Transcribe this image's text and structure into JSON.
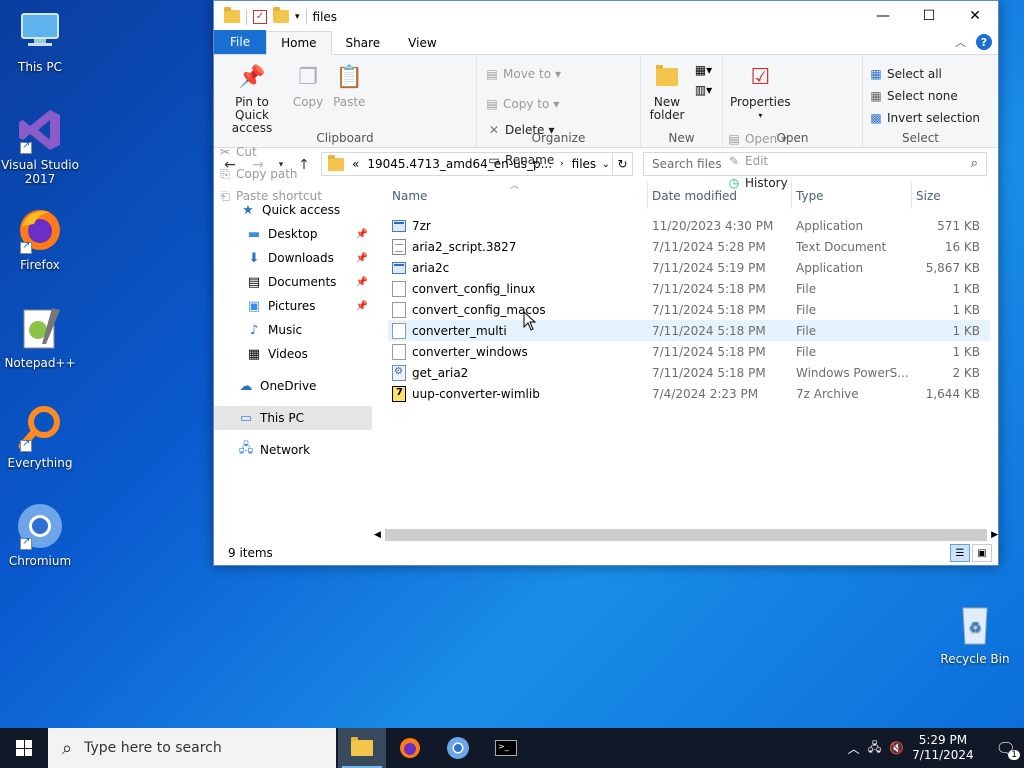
{
  "desktop": {
    "icons": [
      {
        "label": "This PC"
      },
      {
        "label": "Visual Studio\n2017"
      },
      {
        "label": "Firefox"
      },
      {
        "label": "Notepad++"
      },
      {
        "label": "Everything"
      },
      {
        "label": "Chromium"
      },
      {
        "label": "Recycle Bin"
      }
    ]
  },
  "window": {
    "title": "files",
    "ribbon_tabs": [
      "File",
      "Home",
      "Share",
      "View"
    ],
    "clipboard": {
      "pin": "Pin to Quick access",
      "copy": "Copy",
      "paste": "Paste",
      "cut": "Cut",
      "copy_path": "Copy path",
      "paste_shortcut": "Paste shortcut",
      "label": "Clipboard"
    },
    "organize": {
      "move_to": "Move to",
      "copy_to": "Copy to",
      "delete": "Delete",
      "rename": "Rename",
      "label": "Organize"
    },
    "new": {
      "new_folder": "New folder",
      "label": "New"
    },
    "open": {
      "properties": "Properties",
      "open": "Open",
      "edit": "Edit",
      "history": "History",
      "label": "Open"
    },
    "select": {
      "select_all": "Select all",
      "select_none": "Select none",
      "invert": "Invert selection",
      "label": "Select"
    },
    "address": {
      "prefix": "«",
      "segment1": "19045.4713_amd64_en-us_p...",
      "segment2": "files"
    },
    "search_placeholder": "Search files",
    "nav": {
      "quick_access": "Quick access",
      "items": [
        "Desktop",
        "Downloads",
        "Documents",
        "Pictures",
        "Music",
        "Videos"
      ],
      "onedrive": "OneDrive",
      "this_pc": "This PC",
      "network": "Network"
    },
    "columns": {
      "name": "Name",
      "date": "Date modified",
      "type": "Type",
      "size": "Size"
    },
    "files": [
      {
        "name": "7zr",
        "date": "11/20/2023 4:30 PM",
        "type": "Application",
        "size": "571 KB",
        "icon": "app"
      },
      {
        "name": "aria2_script.3827",
        "date": "7/11/2024 5:28 PM",
        "type": "Text Document",
        "size": "16 KB",
        "icon": "doc"
      },
      {
        "name": "aria2c",
        "date": "7/11/2024 5:19 PM",
        "type": "Application",
        "size": "5,867 KB",
        "icon": "app"
      },
      {
        "name": "convert_config_linux",
        "date": "7/11/2024 5:18 PM",
        "type": "File",
        "size": "1 KB",
        "icon": "file"
      },
      {
        "name": "convert_config_macos",
        "date": "7/11/2024 5:18 PM",
        "type": "File",
        "size": "1 KB",
        "icon": "file"
      },
      {
        "name": "converter_multi",
        "date": "7/11/2024 5:18 PM",
        "type": "File",
        "size": "1 KB",
        "icon": "file"
      },
      {
        "name": "converter_windows",
        "date": "7/11/2024 5:18 PM",
        "type": "File",
        "size": "1 KB",
        "icon": "file"
      },
      {
        "name": "get_aria2",
        "date": "7/11/2024 5:18 PM",
        "type": "Windows PowerS...",
        "size": "2 KB",
        "icon": "ps"
      },
      {
        "name": "uup-converter-wimlib",
        "date": "7/4/2024 2:23 PM",
        "type": "7z Archive",
        "size": "1,644 KB",
        "icon": "7z"
      }
    ],
    "status": "9 items"
  },
  "taskbar": {
    "search_placeholder": "Type here to search",
    "time": "5:29 PM",
    "date": "7/11/2024",
    "notification_count": "1"
  }
}
